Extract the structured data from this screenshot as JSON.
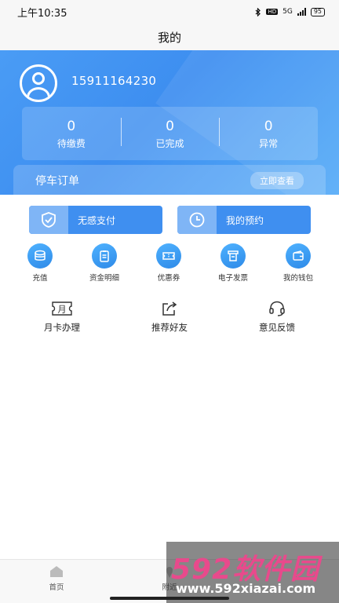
{
  "status_bar": {
    "time": "上午10:35",
    "network": "5G",
    "battery": "95"
  },
  "title": "我的",
  "user": {
    "phone": "15911164230"
  },
  "stats": [
    {
      "value": "0",
      "label": "待缴费"
    },
    {
      "value": "0",
      "label": "已完成"
    },
    {
      "value": "0",
      "label": "异常"
    }
  ],
  "order": {
    "title": "停车订单",
    "action": "立即查看"
  },
  "big_buttons": [
    {
      "label": "无感支付",
      "icon": "shield-check-icon"
    },
    {
      "label": "我的预约",
      "icon": "clock-icon"
    }
  ],
  "icon_items": [
    {
      "label": "充值",
      "icon": "coins-icon"
    },
    {
      "label": "资金明细",
      "icon": "clipboard-icon"
    },
    {
      "label": "优惠券",
      "icon": "ticket-icon"
    },
    {
      "label": "电子发票",
      "icon": "invoice-icon"
    },
    {
      "label": "我的钱包",
      "icon": "wallet-icon"
    }
  ],
  "text_items": [
    {
      "label": "月卡办理",
      "icon_text": "月",
      "icon": "month-card-icon"
    },
    {
      "label": "推荐好友",
      "icon": "share-icon"
    },
    {
      "label": "意见反馈",
      "icon": "headset-icon"
    }
  ],
  "bottom_nav": [
    {
      "label": "首页",
      "icon": "home-icon"
    },
    {
      "label": "附近",
      "icon": "location-icon"
    }
  ],
  "watermark": {
    "line1": "592软件园",
    "line2": "www.592xiazai.com"
  },
  "colors": {
    "primary": "#3f8ff0",
    "header_gradient_start": "#4a9cf5",
    "header_gradient_end": "#56acf8"
  }
}
